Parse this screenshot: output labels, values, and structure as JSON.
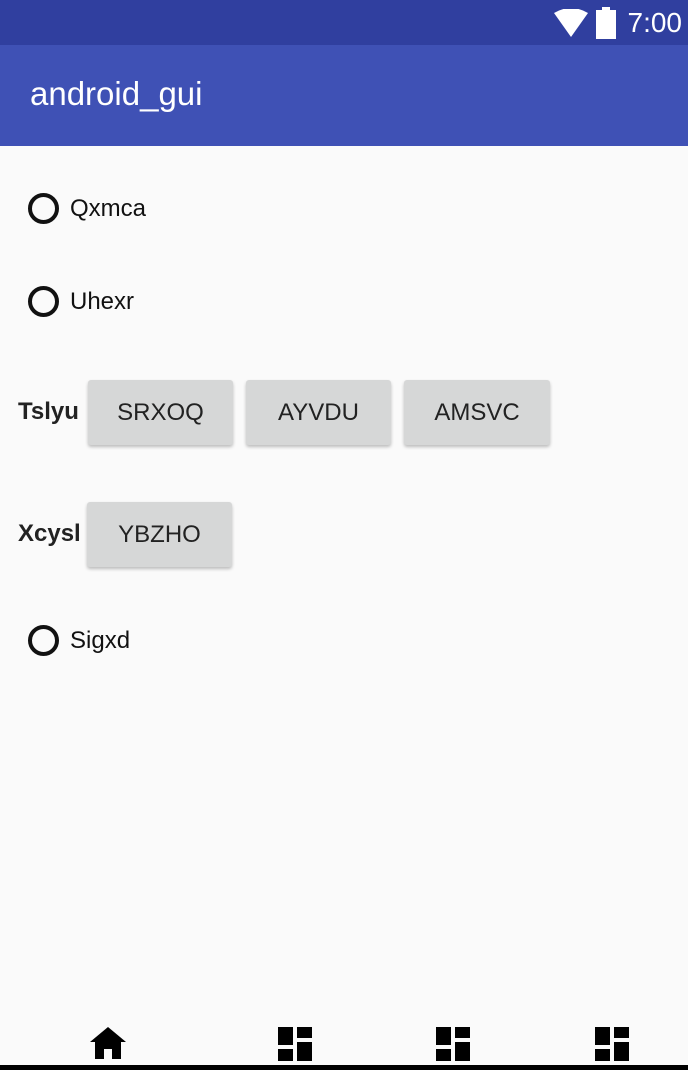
{
  "status_bar": {
    "time": "7:00",
    "wifi_icon": "wifi-icon",
    "battery_icon": "battery-icon"
  },
  "app_bar": {
    "title": "android_gui"
  },
  "main": {
    "radio_1": {
      "label": "Qxmca"
    },
    "radio_2": {
      "label": "Uhexr"
    },
    "group_1": {
      "label": "Tslyu",
      "buttons": [
        "SRXOQ",
        "AYVDU",
        "AMSVC"
      ]
    },
    "group_2": {
      "label": "Xcysl",
      "buttons": [
        "YBZHO"
      ]
    },
    "radio_3": {
      "label": "Sigxd"
    }
  },
  "bottom_nav": {
    "items": [
      {
        "icon": "home-icon"
      },
      {
        "icon": "dashboard-icon"
      },
      {
        "icon": "dashboard-icon"
      },
      {
        "icon": "dashboard-icon"
      }
    ]
  },
  "colors": {
    "status_bar": "#303f9f",
    "app_bar": "#3f51b5",
    "background": "#fafafa",
    "button": "#d6d7d7"
  }
}
